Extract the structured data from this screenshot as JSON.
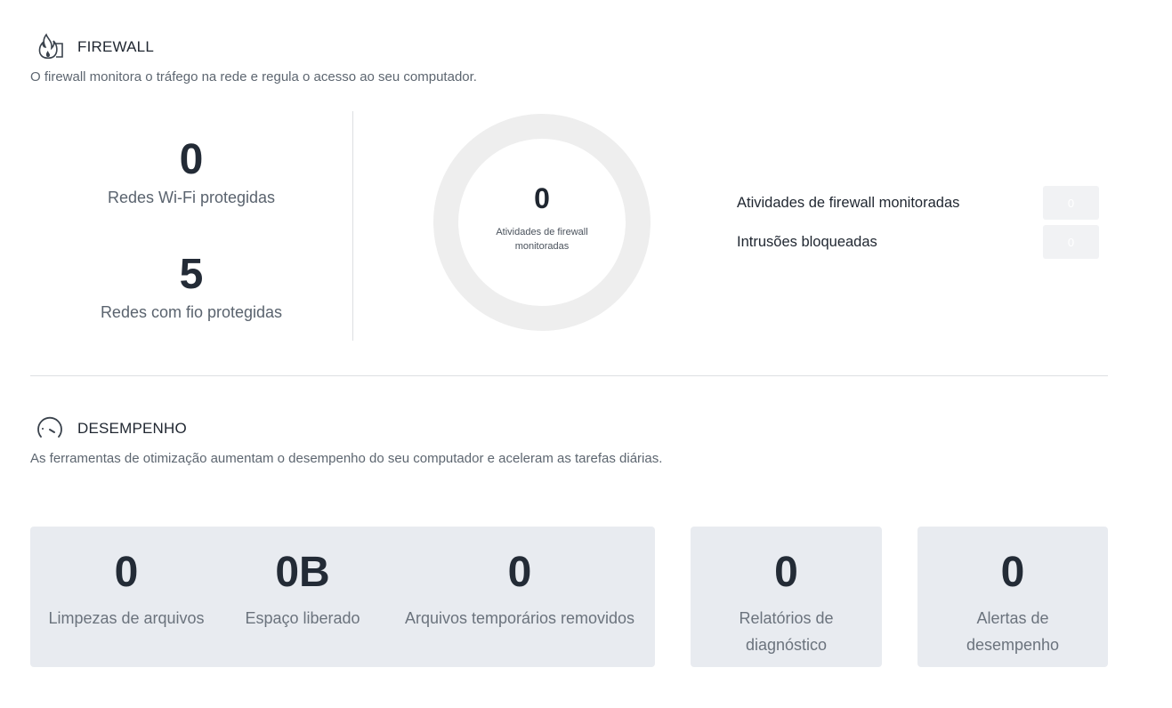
{
  "firewall": {
    "title": "FIREWALL",
    "icon": "firewall-flame-icon",
    "description": "O firewall monitora o tráfego na rede e regula o acesso ao seu computador.",
    "wifi": {
      "value": "0",
      "label": "Redes Wi-Fi protegidas"
    },
    "wired": {
      "value": "5",
      "label": "Redes com fio protegidas"
    },
    "donut": {
      "value": "0",
      "label": "Atividades de firewall monitoradas"
    },
    "legend": [
      {
        "label": "Atividades de firewall monitoradas",
        "value": "0"
      },
      {
        "label": "Intrusões bloqueadas",
        "value": "0"
      }
    ]
  },
  "performance": {
    "title": "DESEMPENHO",
    "icon": "speedometer-icon",
    "description": "As ferramentas de otimização aumentam o desempenho do seu computador e aceleram as tarefas diárias.",
    "cleanups": {
      "value": "0",
      "label": "Limpezas de arquivos"
    },
    "space": {
      "value": "0B",
      "label": "Espaço liberado"
    },
    "temp": {
      "value": "0",
      "label": "Arquivos temporários removidos"
    },
    "reports": {
      "value": "0",
      "label": "Relatórios de diagnóstico"
    },
    "alerts": {
      "value": "0",
      "label": "Alertas de desempenho"
    }
  },
  "colors": {
    "card_bg": "#e8ebf0",
    "donut_ring": "#eeeeee",
    "legend_box": "#f1f2f4"
  }
}
